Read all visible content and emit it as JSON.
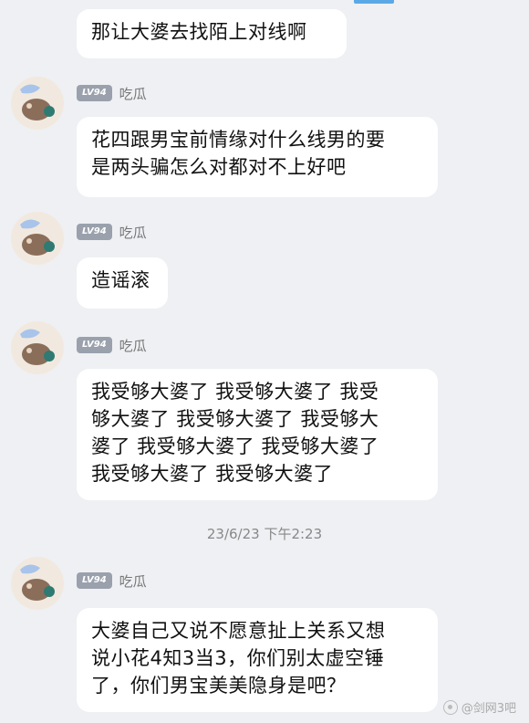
{
  "messages": [
    {
      "text": "那让大婆去找陌上对线啊"
    },
    {
      "sender": "吃瓜",
      "level": "LV94",
      "text": "花四跟男宝前情缘对什么线男的要\n是两头骗怎么对都对不上好吧"
    },
    {
      "sender": "吃瓜",
      "level": "LV94",
      "text": "造谣滚"
    },
    {
      "sender": "吃瓜",
      "level": "LV94",
      "text": "我受够大婆了 我受够大婆了 我受\n够大婆了 我受够大婆了 我受够大\n婆了 我受够大婆了 我受够大婆了\n我受够大婆了 我受够大婆了"
    },
    {
      "sender": "吃瓜",
      "level": "LV94",
      "text": "大婆自己又说不愿意扯上关系又想\n说小花4知3当3，你们别太虚空锤\n了，你们男宝美美隐身是吧？"
    }
  ],
  "timestamp": "23/6/23 下午2:23",
  "watermark": "@剑网3吧",
  "colors": {
    "background": "#eef0f3",
    "bubble": "#ffffff",
    "level_badge": "#9aa1ad",
    "accent": "#5aa9e6"
  }
}
